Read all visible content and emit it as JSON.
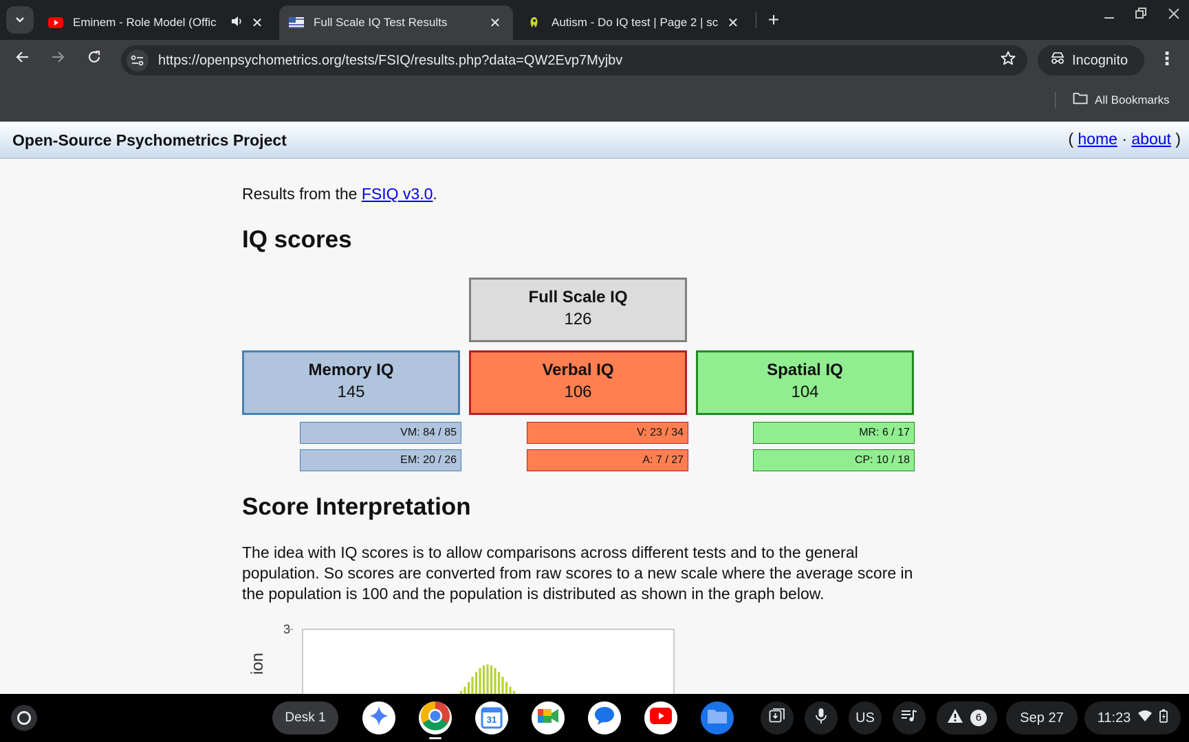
{
  "browser": {
    "tabs": [
      {
        "title": "Eminem - Role Model (Offic",
        "favicon": "youtube-icon",
        "audio": true,
        "active": false
      },
      {
        "title": "Full Scale IQ Test Results",
        "favicon": "flag-icon",
        "audio": false,
        "active": true
      },
      {
        "title": "Autism - Do IQ test | Page 2 | sc",
        "favicon": "forum-icon",
        "audio": false,
        "active": false
      }
    ],
    "url": "https://openpsychometrics.org/tests/FSIQ/results.php?data=QW2Evp7Myjbv",
    "incognito_label": "Incognito",
    "all_bookmarks_label": "All Bookmarks"
  },
  "site": {
    "name": "Open-Source Psychometrics Project",
    "links_open": "(",
    "link_home": "home",
    "link_sep": "·",
    "link_about": "about",
    "links_close": ")"
  },
  "results": {
    "intro_prefix": "Results from the ",
    "intro_link": "FSIQ v3.0",
    "intro_suffix": ".",
    "heading": "IQ scores",
    "full": {
      "name": "Full Scale IQ",
      "value": "126"
    },
    "memory": {
      "name": "Memory IQ",
      "value": "145",
      "sub": [
        "VM: 84 / 85",
        "EM: 20 / 26"
      ]
    },
    "verbal": {
      "name": "Verbal IQ",
      "value": "106",
      "sub": [
        "V: 23 / 34",
        "A: 7 / 27"
      ]
    },
    "spatial": {
      "name": "Spatial IQ",
      "value": "104",
      "sub": [
        "MR: 6 / 17",
        "CP: 10 / 18"
      ]
    }
  },
  "interpretation": {
    "heading": "Score Interpretation",
    "text": "The idea with IQ scores is to allow comparisons across different tests and to the general population. So scores are converted from raw scores to a new scale where the average score in the population is 100 and the population is distributed as shown in the graph below."
  },
  "chart_data": {
    "type": "bar",
    "ytick_top": "3",
    "ylabel_fragment": "ion",
    "bar_color": "#b5d334"
  },
  "shelf": {
    "desk_label": "Desk 1",
    "calendar_day": "31",
    "ime_label": "US",
    "notification_count": "6",
    "date": "Sep 27",
    "time": "11:23"
  }
}
